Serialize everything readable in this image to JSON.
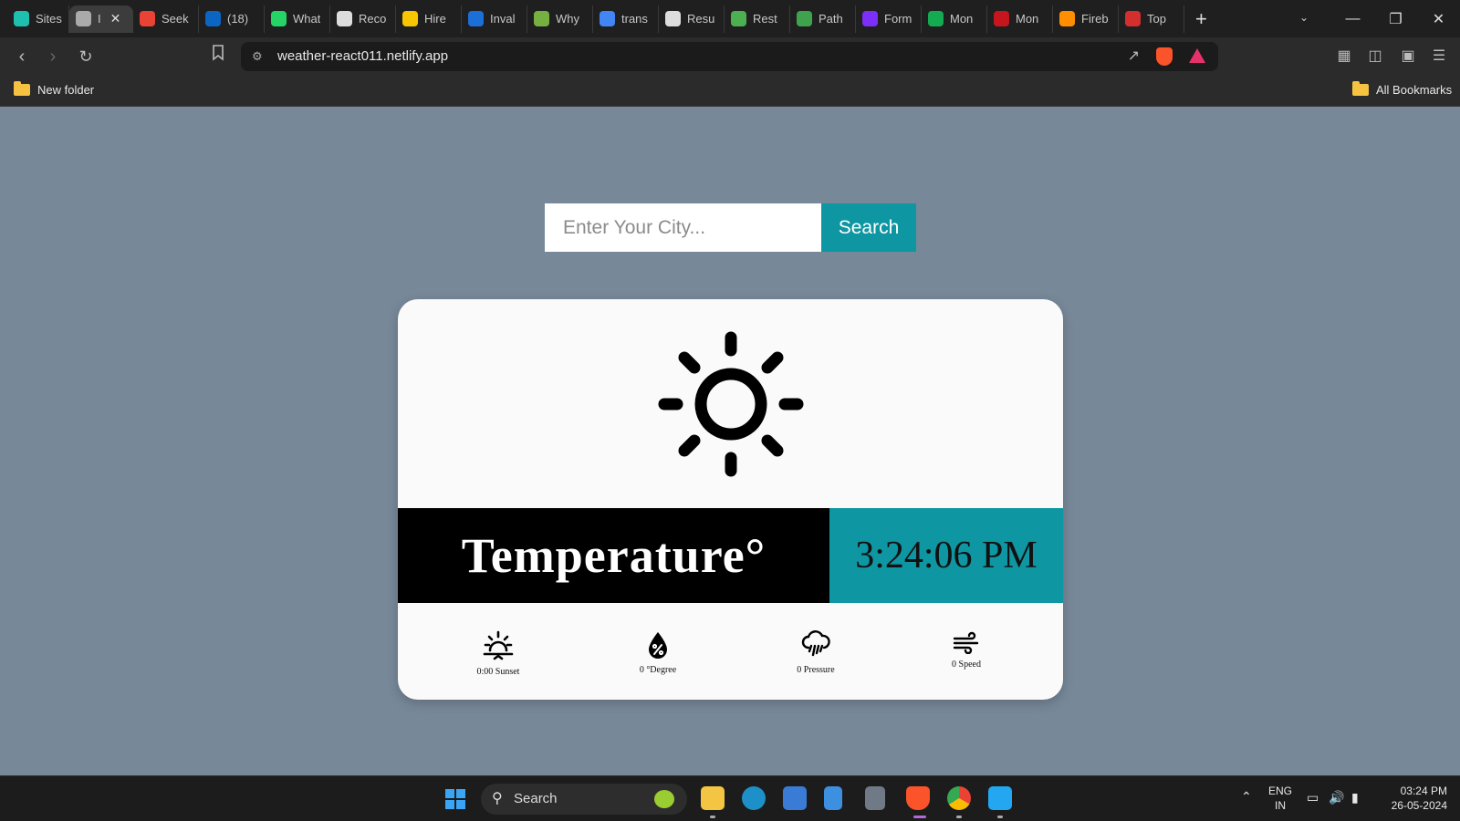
{
  "browser": {
    "tabs": [
      {
        "title": "Sites",
        "color": "#1fbfb0"
      },
      {
        "title": "I",
        "color": "#aaaaaa",
        "active": true
      },
      {
        "title": "Seek",
        "color": "#ea4335"
      },
      {
        "title": "(18)",
        "color": "#0a66c2"
      },
      {
        "title": "What",
        "color": "#25d366"
      },
      {
        "title": "Reco",
        "color": "#dddddd"
      },
      {
        "title": "Hire",
        "color": "#f7c600"
      },
      {
        "title": "Inval",
        "color": "#1d6fd8"
      },
      {
        "title": "Why",
        "color": "#76b041"
      },
      {
        "title": "trans",
        "color": "#4285f4"
      },
      {
        "title": "Resu",
        "color": "#dddddd"
      },
      {
        "title": "Rest",
        "color": "#4caf50"
      },
      {
        "title": "Path",
        "color": "#3fa34d"
      },
      {
        "title": "Form",
        "color": "#7b2ff7"
      },
      {
        "title": "Mon",
        "color": "#13aa52"
      },
      {
        "title": "Mon",
        "color": "#c4161c"
      },
      {
        "title": "Fireb",
        "color": "#ff8f00"
      },
      {
        "title": "Top",
        "color": "#d32f2f"
      }
    ],
    "url": "weather-react011.netlify.app",
    "bookmarks": {
      "left": "New folder",
      "right": "All Bookmarks"
    }
  },
  "search": {
    "placeholder": "Enter Your City...",
    "button_label": "Search"
  },
  "weather": {
    "temperature_label": "Temperature°",
    "time": "3:24:06 PM",
    "stats": [
      {
        "icon": "sunset-icon",
        "label": "0:00 Sunset"
      },
      {
        "icon": "humidity-icon",
        "label": "0 °Degree"
      },
      {
        "icon": "rain-icon",
        "label": "0 Pressure"
      },
      {
        "icon": "wind-icon",
        "label": "0 Speed"
      }
    ]
  },
  "taskbar": {
    "search_label": "Search",
    "lang_top": "ENG",
    "lang_bottom": "IN",
    "clock_time": "03:24 PM",
    "clock_date": "26-05-2024"
  },
  "colors": {
    "page_bg": "#778899",
    "accent": "#0f96a3",
    "card_bg": "#fafafa"
  }
}
